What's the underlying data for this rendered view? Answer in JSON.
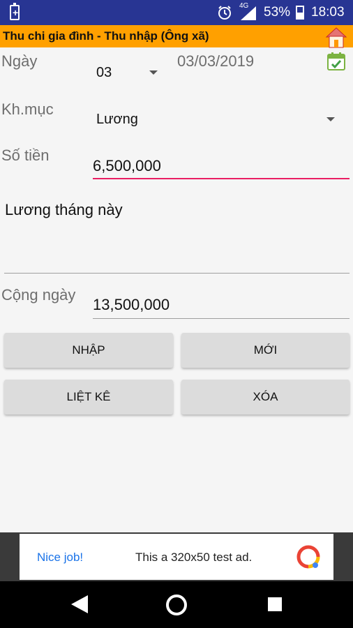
{
  "status_bar": {
    "network": "4G",
    "battery_percent": "53%",
    "time": "18:03",
    "colors": {
      "background": "#283593"
    }
  },
  "titlebar": {
    "title": "Thu chi gia đình - Thu nhập (Ông xã)",
    "colors": {
      "background": "#ffa000"
    }
  },
  "form": {
    "date_label": "Ngày",
    "day_value": "03",
    "date_value": "03/03/2019",
    "category_label": "Kh.mục",
    "category_value": "Lương",
    "amount_label": "Số tiền",
    "amount_value": "6,500,000",
    "note_value": "Lương tháng này",
    "total_label": "Cộng ngày",
    "total_value": "13,500,000",
    "colors": {
      "amount_underline": "#e91e63"
    }
  },
  "buttons": {
    "enter": "NHẬP",
    "new": "MỚI",
    "list": "LIỆT KÊ",
    "delete": "XÓA"
  },
  "ad": {
    "headline": "Nice job!",
    "body": "This a 320x50 test ad."
  },
  "icons": {
    "status": [
      "battery-charging-icon",
      "alarm-icon",
      "signal-icon",
      "battery-icon"
    ],
    "app": [
      "home-icon",
      "calendar-check-icon"
    ],
    "nav": [
      "back-icon",
      "home-circle-icon",
      "recents-square-icon"
    ]
  }
}
